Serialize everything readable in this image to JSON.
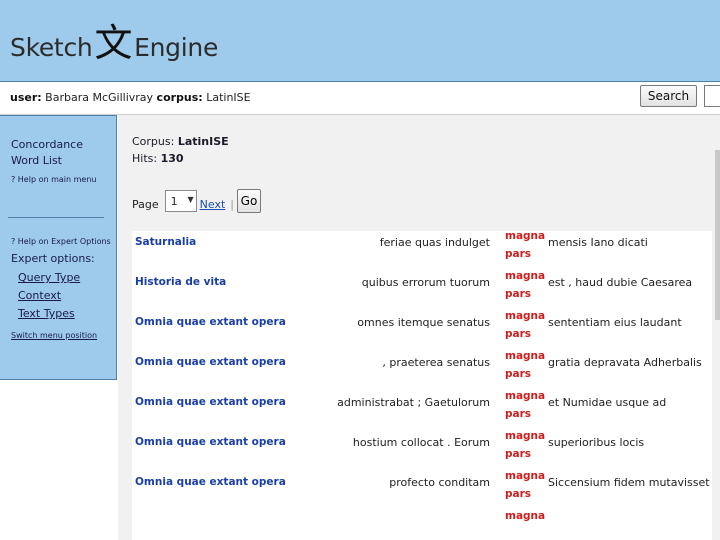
{
  "logo": {
    "left_text": "Sketch",
    "glyph": "文",
    "right_text": "Engine"
  },
  "userbar": {
    "user_label": "user:",
    "user_name": "Barbara McGillivray",
    "corpus_label": "corpus:",
    "corpus_name": "LatinISE",
    "search_button": "Search",
    "search_value": ""
  },
  "sidebar": {
    "concordance": "Concordance",
    "word_list": "Word List",
    "help_main": "? Help on main menu",
    "help_expert": "? Help on Expert Options",
    "expert_options": "Expert options:",
    "query_type": "Query Type",
    "context": "Context",
    "text_types": "Text Types",
    "switch_menu": "Switch menu position"
  },
  "main": {
    "corpus_label": "Corpus:",
    "corpus_name": "LatinISE",
    "hits_label": "Hits:",
    "hits_count": "130",
    "page_label": "Page",
    "page_value": "1",
    "next_label": "Next",
    "go_button": "Go"
  },
  "results": [
    {
      "ref": "Saturnalia",
      "left": "feriae quas indulget",
      "kwic1": "magna",
      "kwic2": "pars",
      "right": "mensis Iano dicati"
    },
    {
      "ref": "Historia de vita",
      "left": "quibus errorum tuorum",
      "kwic1": "magna",
      "kwic2": "pars",
      "right": "est , haud dubie Caesarea"
    },
    {
      "ref": "Omnia quae extant opera",
      "left": "omnes itemque senatus",
      "kwic1": "magna",
      "kwic2": "pars",
      "right": "sententiam eius laudant"
    },
    {
      "ref": "Omnia quae extant opera",
      "left": ", praeterea senatus",
      "kwic1": "magna",
      "kwic2": "pars",
      "right": "gratia depravata Adherbalis"
    },
    {
      "ref": "Omnia quae extant opera",
      "left": "administrabat ; Gaetulorum",
      "kwic1": "magna",
      "kwic2": "pars",
      "right": "et Numidae usque ad"
    },
    {
      "ref": "Omnia quae extant opera",
      "left": "hostium collocat . Eorum",
      "kwic1": "magna",
      "kwic2": "pars",
      "right": "superioribus locis"
    },
    {
      "ref": "Omnia quae extant opera",
      "left": "profecto conditam",
      "kwic1": "magna",
      "kwic2": "pars",
      "right": "Siccensium fidem mutavisset"
    },
    {
      "ref": "",
      "left": "",
      "kwic1": "magna",
      "kwic2": "",
      "right": ""
    }
  ]
}
